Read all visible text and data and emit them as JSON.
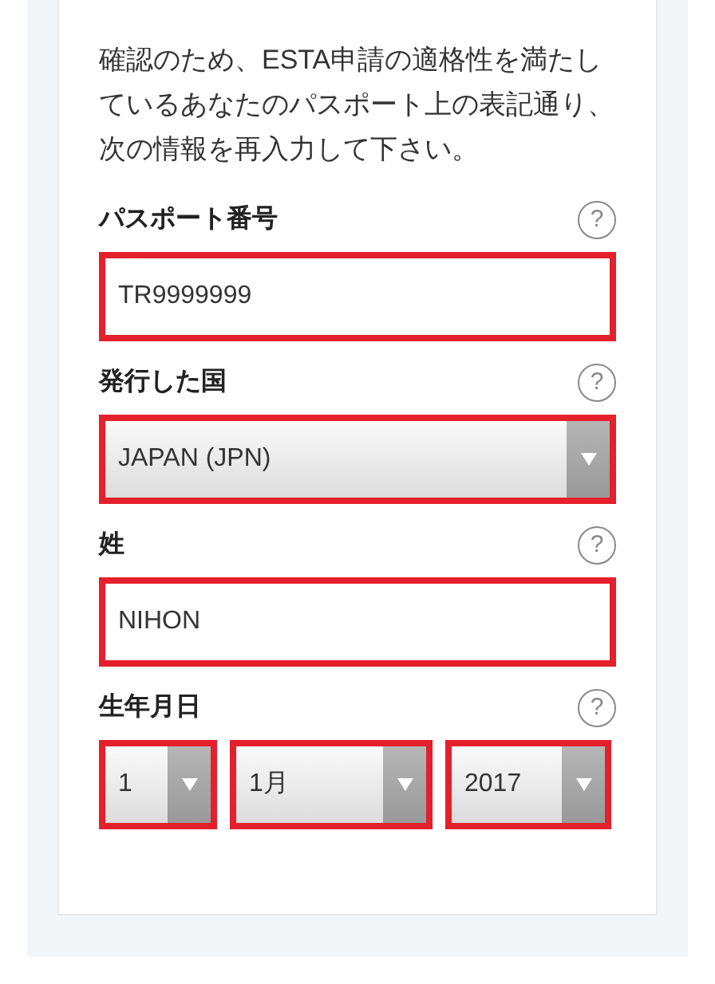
{
  "intro": "確認のため、ESTA申請の適格性を満たしているあなたのパスポート上の表記通り、次の情報を再入力して下さい。",
  "fields": [
    {
      "kind": "text",
      "label": "パスポート番号",
      "help": "?",
      "value": "TR9999999",
      "highlighted": true
    },
    {
      "kind": "select",
      "label": "発行した国",
      "help": "?",
      "value": "JAPAN (JPN)",
      "highlighted": true
    },
    {
      "kind": "text",
      "label": "姓",
      "help": "?",
      "value": "NIHON",
      "highlighted": true
    },
    {
      "kind": "date",
      "label": "生年月日",
      "help": "?",
      "parts": [
        {
          "value": "1",
          "highlighted": true
        },
        {
          "value": "1月",
          "highlighted": true
        },
        {
          "value": "2017",
          "highlighted": true
        }
      ]
    }
  ]
}
